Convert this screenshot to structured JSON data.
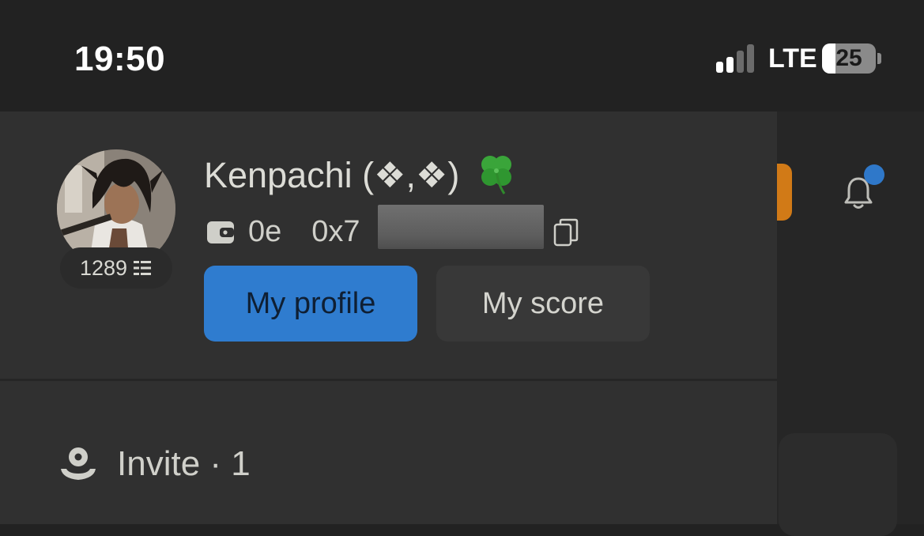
{
  "status_bar": {
    "time": "19:50",
    "network": "LTE",
    "signal_bars_active": 2,
    "signal_bars_total": 4,
    "battery_percent": 25,
    "battery_label": "25"
  },
  "profile": {
    "username": "Kenpachi (❖,❖)",
    "score": "1289",
    "wallet_balance": "0e",
    "wallet_address_visible": "0x7",
    "my_profile_label": "My profile",
    "my_score_label": "My score"
  },
  "invite": {
    "label": "Invite · 1"
  },
  "icons": {
    "wallet": "wallet-icon",
    "copy": "copy-icon",
    "clover": "four-leaf-clover-icon",
    "score": "list-icon",
    "invite": "user-icon",
    "bell": "bell-icon"
  },
  "colors": {
    "accent": "#2f7ccf",
    "notification_dot": "#2f78c9",
    "orange": "#d17a17",
    "drawer_bg": "#303030",
    "page_bg": "#222222"
  }
}
